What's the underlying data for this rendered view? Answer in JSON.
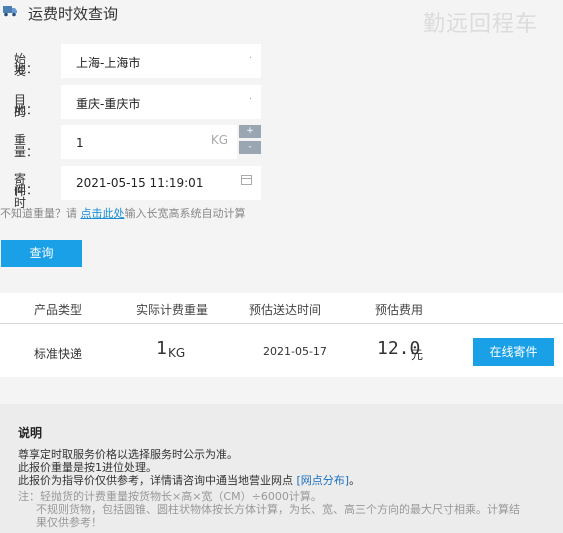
{
  "header": {
    "title": "运费时效查询",
    "watermark": "勤远回程车"
  },
  "form": {
    "origin": {
      "label_line1": "始发",
      "label_line2": "地：",
      "value": "上海-上海市"
    },
    "destination": {
      "label_line1": "目的",
      "label_line2": "地：",
      "value": "重庆-重庆市"
    },
    "weight": {
      "label": "重量：",
      "value": "1",
      "unit": "KG",
      "inc": "+",
      "dec": "-"
    },
    "send_time": {
      "label_line1": "寄件时",
      "label_line2": "间：",
      "value": "2021-05-15 11:19:01"
    },
    "hint_prefix": "不知道重量？请 ",
    "hint_link": "点击此处",
    "hint_suffix": "输入长宽高系统自动计算",
    "query_button": "查询"
  },
  "results": {
    "headers": [
      "产品类型",
      "实际计费重量",
      "预估送达时间",
      "预估费用"
    ],
    "row": {
      "product": "标准快递",
      "weight": "1",
      "weight_unit": "KG",
      "eta": "2021-05-17",
      "fee": "12.0",
      "fee_unit": "元",
      "action": "在线寄件"
    }
  },
  "notes": {
    "title": "说明",
    "line1": "尊享定时取服务价格以选择服务时公示为准。",
    "line2": "此报价重量是按1进位处理。",
    "line3_prefix": "此报价为指导价仅供参考，详情请咨询中通当地营业网点 ",
    "line3_link": "[网点分布]",
    "line3_suffix": "。",
    "note1": "注：轻抛货的计费重量按货物长×高×宽（CM）÷6000计算。",
    "note2": "不规则货物，包括圆锥、圆柱状物体按长方体计算，为长、宽、高三个方向的最大尺寸相乘。计算结",
    "note3": "果仅供参考！"
  }
}
